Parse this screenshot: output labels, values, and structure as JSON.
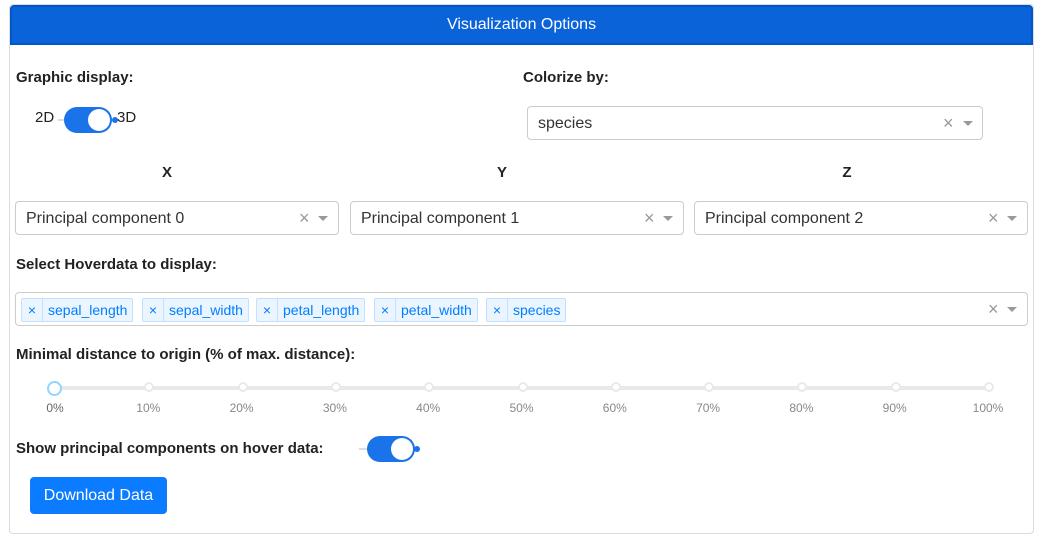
{
  "header": {
    "title": "Visualization Options"
  },
  "graphic_display": {
    "label": "Graphic display:",
    "left": "2D",
    "right": "3D",
    "value": "3D"
  },
  "colorize": {
    "label": "Colorize by:",
    "value": "species"
  },
  "axes": {
    "x": {
      "label": "X",
      "value": "Principal component 0"
    },
    "y": {
      "label": "Y",
      "value": "Principal component 1"
    },
    "z": {
      "label": "Z",
      "value": "Principal component 2"
    }
  },
  "hoverdata": {
    "label": "Select Hoverdata to display:",
    "tags": [
      "sepal_length",
      "sepal_width",
      "petal_length",
      "petal_width",
      "species"
    ]
  },
  "distance": {
    "label": "Minimal distance to origin (% of max. distance):",
    "value": 0,
    "marks": [
      "0%",
      "10%",
      "20%",
      "30%",
      "40%",
      "50%",
      "60%",
      "70%",
      "80%",
      "90%",
      "100%"
    ]
  },
  "show_pc": {
    "label": "Show principal components on hover data:",
    "value": true
  },
  "download": {
    "label": "Download Data"
  },
  "colors": {
    "primary": "#0a63d9",
    "button": "#0b7bff",
    "tag_bg": "#ebf5ff",
    "tag_text": "#007eff"
  }
}
